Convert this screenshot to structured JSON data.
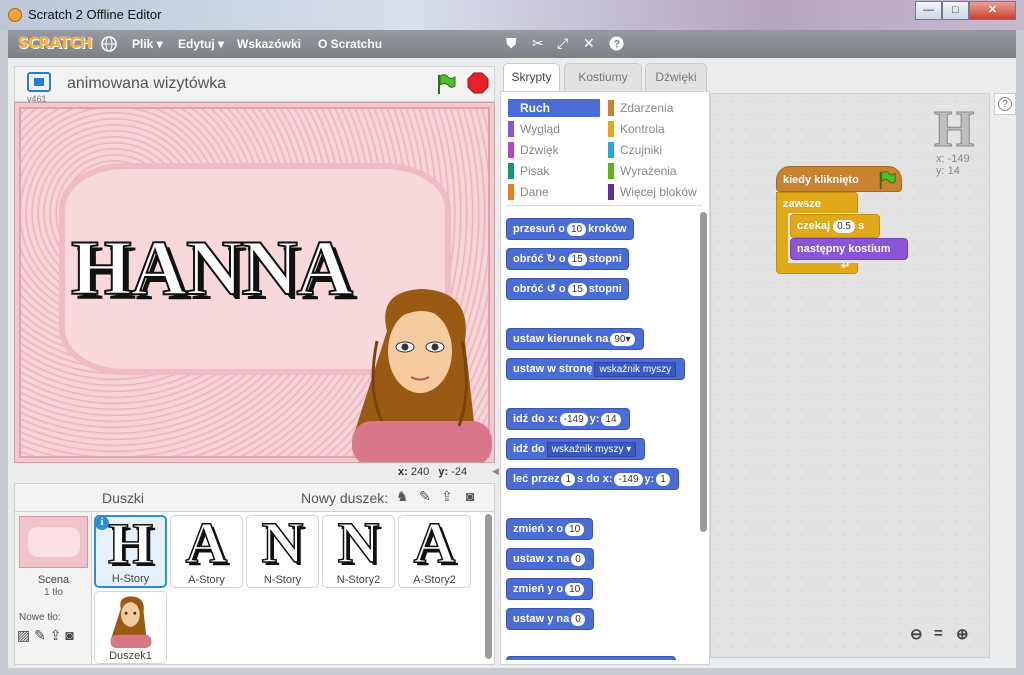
{
  "window": {
    "title": "Scratch 2 Offline Editor",
    "minimize": "—",
    "maximize": "□",
    "close": "✕"
  },
  "menu": {
    "logo": "SCRATCH",
    "file": "Plik ▾",
    "edit": "Edytuj ▾",
    "tips": "Wskazówki",
    "about": "O Scratchu"
  },
  "stage": {
    "project_title": "animowana wizytówka",
    "version": "v461",
    "text": "HANNA",
    "x_label": "x:",
    "x_value": "240",
    "y_label": "y:",
    "y_value": "-24"
  },
  "sprites_pane": {
    "title": "Duszki",
    "new_sprite": "Nowy duszek:",
    "scene_label": "Scena",
    "scene_sub": "1 tło",
    "new_backdrop": "Nowe tło:",
    "sprites": [
      {
        "name": "H-Story",
        "glyph": "H"
      },
      {
        "name": "A-Story",
        "glyph": "A"
      },
      {
        "name": "N-Story",
        "glyph": "N"
      },
      {
        "name": "N-Story2",
        "glyph": "N"
      },
      {
        "name": "A-Story2",
        "glyph": "A"
      },
      {
        "name": "Duszek1",
        "glyph": ""
      }
    ]
  },
  "tabs": [
    "Skrypty",
    "Kostiumy",
    "Dźwięki"
  ],
  "categories": [
    {
      "label": "Ruch",
      "color": "#4a6cd4"
    },
    {
      "label": "Zdarzenia",
      "color": "#c88330"
    },
    {
      "label": "Wygląd",
      "color": "#8a55d7"
    },
    {
      "label": "Kontrola",
      "color": "#e1a91a"
    },
    {
      "label": "Dźwięk",
      "color": "#bb42c3"
    },
    {
      "label": "Czujniki",
      "color": "#2ca5e2"
    },
    {
      "label": "Pisak",
      "color": "#0e9a6c"
    },
    {
      "label": "Wyrażenia",
      "color": "#5cb712"
    },
    {
      "label": "Dane",
      "color": "#ee7d16"
    },
    {
      "label": "Więcej bloków",
      "color": "#632d99"
    }
  ],
  "blocks": {
    "move": {
      "a": "przesuń o",
      "v": "10",
      "b": "kroków"
    },
    "turn_r": {
      "a": "obróć",
      "b": "o",
      "v": "15",
      "c": "stopni"
    },
    "turn_l": {
      "a": "obróć",
      "b": "o",
      "v": "15",
      "c": "stopni"
    },
    "point_dir": {
      "a": "ustaw kierunek na",
      "v": "90▾"
    },
    "point_to": {
      "a": "ustaw w stronę",
      "v": "wskaźnik myszy"
    },
    "goto_xy": {
      "a": "idź do x:",
      "x": "-149",
      "b": "y:",
      "y": "14"
    },
    "goto": {
      "a": "idź do",
      "v": "wskaźnik myszy ▾"
    },
    "glide": {
      "a": "leć przez",
      "s": "1",
      "b": "s do x:",
      "x": "-149",
      "c": "y:",
      "y": "1"
    },
    "change_x": {
      "a": "zmień x o",
      "v": "10"
    },
    "set_x": {
      "a": "ustaw x na",
      "v": "0"
    },
    "change_y": {
      "a": "zmień y o",
      "v": "10"
    },
    "set_y": {
      "a": "ustaw y na",
      "v": "0"
    }
  },
  "script": {
    "sprite_glyph": "H",
    "sprite_x": "x: -149",
    "sprite_y": "y:  14",
    "hat": "kiedy kliknięto",
    "forever": "zawsze",
    "wait_a": "czekaj",
    "wait_v": "0.5",
    "wait_b": "s",
    "next_costume": "następny kostium"
  },
  "help": "?"
}
